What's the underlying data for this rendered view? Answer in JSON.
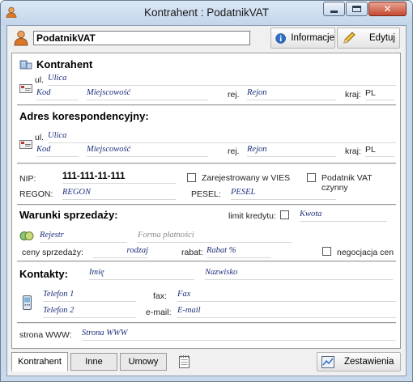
{
  "window": {
    "title": "Kontrahent : PodatnikVAT"
  },
  "toolbar": {
    "name_value": "PodatnikVAT",
    "info_label": "Informacje",
    "edit_label": "Edytuj"
  },
  "contractor": {
    "heading": "Kontrahent",
    "street_label": "ul.",
    "street": "Ulica",
    "postcode": "Kod",
    "city": "Miejscowość",
    "region_label": "rej.",
    "region": "Rejon",
    "country_label": "kraj:",
    "country": "PL"
  },
  "correspondence": {
    "heading": "Adres korespondencyjny:",
    "street_label": "ul.",
    "street": "Ulica",
    "postcode": "Kod",
    "city": "Miejscowość",
    "region_label": "rej.",
    "region": "Rejon",
    "country_label": "kraj:",
    "country": "PL"
  },
  "ids": {
    "nip_label": "NIP:",
    "nip": "111-111-11-111",
    "vies_label": "Zarejestrowany w VIES",
    "vat_label": "Podatnik VAT czynny",
    "regon_label": "REGON:",
    "regon": "REGON",
    "pesel_label": "PESEL:",
    "pesel": "PESEL"
  },
  "sales": {
    "heading": "Warunki sprzedaży:",
    "credit_label": "limit kredytu:",
    "credit": "Kwota",
    "register": "Rejestr",
    "payment_form": "Forma płatności",
    "prices_label": "ceny sprzedaży:",
    "prices": "rodzaj",
    "discount_label": "rabat:",
    "discount": "Rabat %",
    "negotiation_label": "negocjacja cen"
  },
  "contacts": {
    "heading": "Kontakty:",
    "first_name": "Imię",
    "last_name": "Nazwisko",
    "phone1": "Telefon 1",
    "phone2": "Telefon 2",
    "fax_label": "fax:",
    "fax": "Fax",
    "email_label": "e-mail:",
    "email": "E-mail"
  },
  "website": {
    "label": "strona WWW:",
    "value": "Strona WWW"
  },
  "tabs": [
    {
      "label": "Kontrahent"
    },
    {
      "label": "Inne"
    },
    {
      "label": "Umowy"
    }
  ],
  "footer": {
    "summary_label": "Zestawienia"
  },
  "colors": {
    "value_text": "#1d2f7a",
    "titlebar": "#c9d9ec"
  }
}
